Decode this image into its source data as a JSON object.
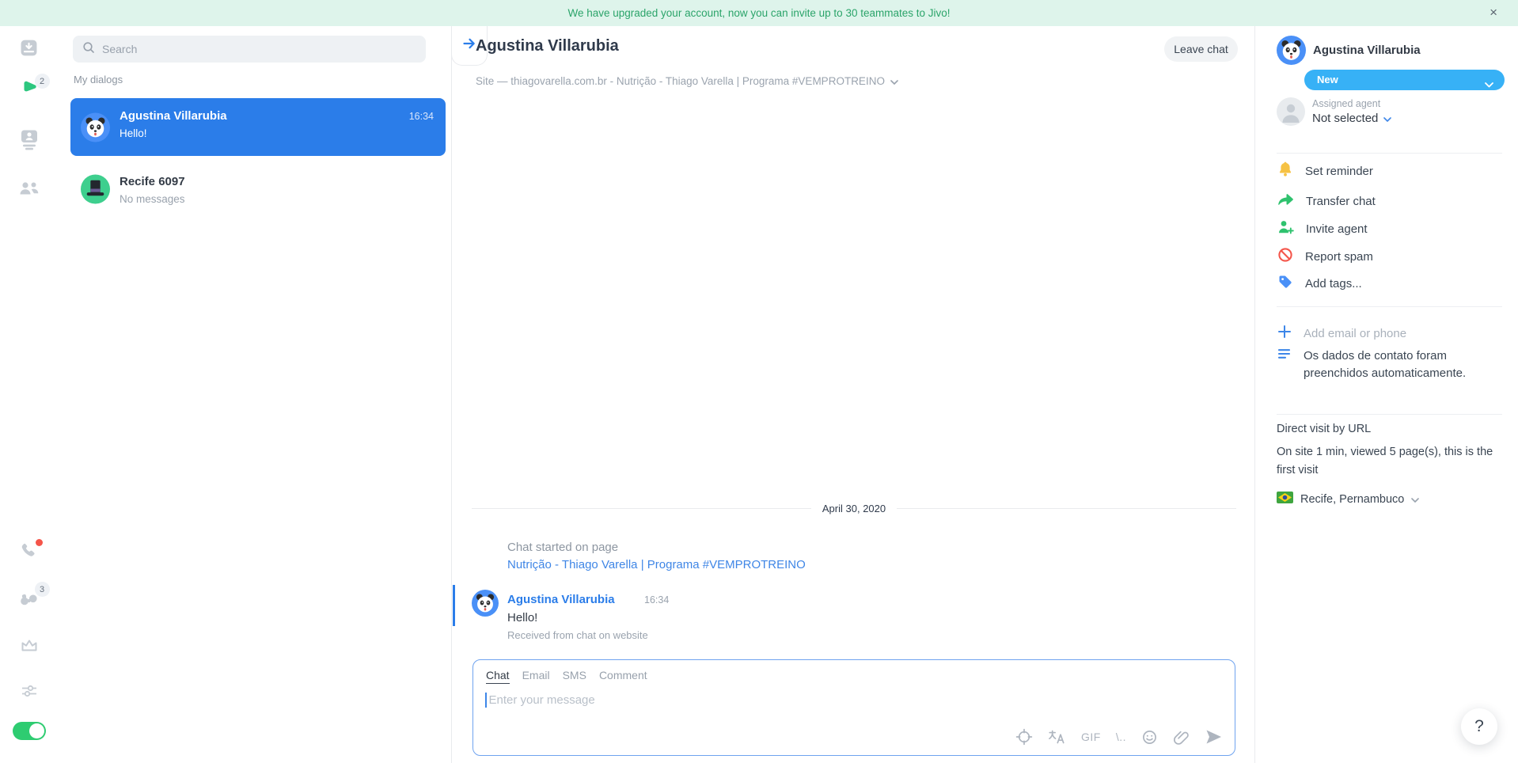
{
  "banner": {
    "text": "We have upgraded your account, now you can invite up to 30 teammates to Jivo!",
    "close_label": "×"
  },
  "rail": {
    "chats_badge": "2",
    "phone_badge": "3"
  },
  "dialogs": {
    "search_placeholder": "Search",
    "section_label": "My dialogs",
    "items": [
      {
        "name": "Agustina Villarubia",
        "time": "16:34",
        "preview": "Hello!"
      },
      {
        "name": "Recife 6097",
        "time": "",
        "preview": "No messages"
      }
    ]
  },
  "chat": {
    "title": "Agustina Villarubia",
    "leave_label": "Leave chat",
    "source": "Site — thiagovarella.com.br - Nutrição - Thiago Varella | Programa #VEMPROTREINO",
    "date": "April 30, 2020",
    "started_label": "Chat started on page",
    "started_link": "Nutrição - Thiago Varella | Programa #VEMPROTREINO",
    "message": {
      "author": "Agustina Villarubia",
      "time": "16:34",
      "text": "Hello!",
      "meta": "Received from chat on website"
    },
    "composer": {
      "tabs": [
        "Chat",
        "Email",
        "SMS",
        "Comment"
      ],
      "active_tab": "Chat",
      "placeholder": "Enter your message",
      "gif_label": "GIF",
      "shortcuts_label": "\\.."
    }
  },
  "details": {
    "name": "Agustina Villarubia",
    "status": "New",
    "assigned_label": "Assigned agent",
    "assigned_value": "Not selected",
    "actions": [
      {
        "label": "Set reminder"
      },
      {
        "label": "Transfer chat"
      },
      {
        "label": "Invite agent"
      },
      {
        "label": "Report spam"
      },
      {
        "label": "Add tags..."
      }
    ],
    "add_contact": "Add email or phone",
    "note": "Os dados de contato foram preenchidos automaticamente.",
    "visit_title": "Direct visit by URL",
    "visit_info": "On site 1 min, viewed 5 page(s), this is the first visit",
    "location": "Recife, Pernambuco"
  },
  "help": {
    "label": "?"
  },
  "colors": {
    "accent_blue": "#2b7de9",
    "status_blue": "#37b1f6",
    "link_blue": "#3f86e6",
    "green": "#2dc77f",
    "red": "#f5554a",
    "yellow": "#f6c244",
    "banner_bg": "#def4eb",
    "banner_text": "#2ba46a"
  }
}
